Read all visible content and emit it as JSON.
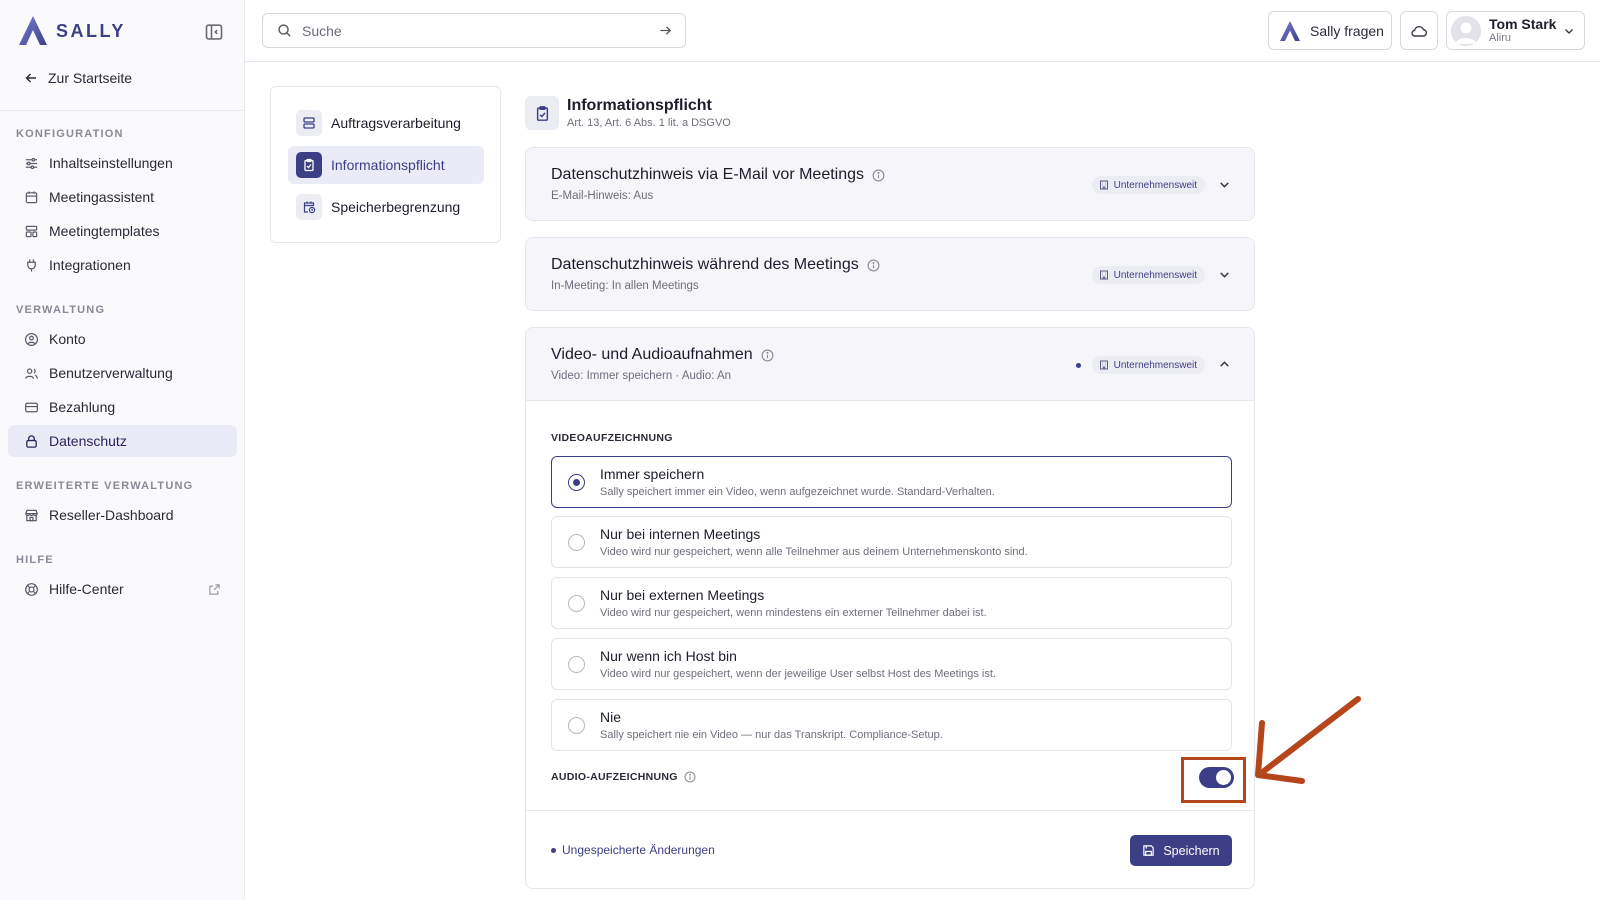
{
  "brand": {
    "name": "SALLY"
  },
  "sidebar": {
    "back_label": "Zur Startseite",
    "sections": [
      {
        "title": "KONFIGURATION",
        "items": [
          {
            "label": "Inhaltseinstellungen",
            "icon": "sliders-icon"
          },
          {
            "label": "Meetingassistent",
            "icon": "calendar-icon"
          },
          {
            "label": "Meetingtemplates",
            "icon": "template-icon"
          },
          {
            "label": "Integrationen",
            "icon": "plug-icon"
          }
        ]
      },
      {
        "title": "VERWALTUNG",
        "items": [
          {
            "label": "Konto",
            "icon": "user-circle-icon"
          },
          {
            "label": "Benutzerverwaltung",
            "icon": "users-icon"
          },
          {
            "label": "Bezahlung",
            "icon": "credit-card-icon"
          },
          {
            "label": "Datenschutz",
            "icon": "lock-icon",
            "active": true
          }
        ]
      },
      {
        "title": "ERWEITERTE VERWALTUNG",
        "items": [
          {
            "label": "Reseller-Dashboard",
            "icon": "store-icon"
          }
        ]
      },
      {
        "title": "HILFE",
        "items": [
          {
            "label": "Hilfe-Center",
            "icon": "lifebuoy-icon",
            "external": true
          }
        ]
      }
    ]
  },
  "topbar": {
    "search_placeholder": "Suche",
    "ask_label": "Sally fragen",
    "user": {
      "name": "Tom Stark",
      "org": "Aliru"
    }
  },
  "subnav": {
    "items": [
      {
        "label": "Auftragsverarbeitung",
        "icon": "server-icon"
      },
      {
        "label": "Informationspflicht",
        "icon": "clipboard-check-icon",
        "active": true
      },
      {
        "label": "Speicherbegrenzung",
        "icon": "calendar-clock-icon"
      }
    ]
  },
  "page": {
    "title": "Informationspflicht",
    "subtitle": "Art. 13, Art. 6 Abs. 1 lit. a DSGVO"
  },
  "accordions": [
    {
      "title": "Datenschutzhinweis via E-Mail vor Meetings",
      "summary": "E-Mail-Hinweis: Aus",
      "badge": "Unternehmensweit",
      "expanded": false
    },
    {
      "title": "Datenschutzhinweis während des Meetings",
      "summary": "In-Meeting: In allen Meetings",
      "badge": "Unternehmensweit",
      "expanded": false
    },
    {
      "title": "Video- und Audioaufnahmen",
      "summary": "Video: Immer speichern · Audio: An",
      "badge": "Unternehmensweit",
      "expanded": true,
      "modified": true
    }
  ],
  "video_section": {
    "label": "VIDEOAUFZEICHNUNG",
    "options": [
      {
        "title": "Immer speichern",
        "desc": "Sally speichert immer ein Video, wenn aufgezeichnet wurde. Standard-Verhalten.",
        "selected": true
      },
      {
        "title": "Nur bei internen Meetings",
        "desc": "Video wird nur gespeichert, wenn alle Teilnehmer aus deinem Unternehmenskonto sind.",
        "selected": false
      },
      {
        "title": "Nur bei externen Meetings",
        "desc": "Video wird nur gespeichert, wenn mindestens ein externer Teilnehmer dabei ist.",
        "selected": false
      },
      {
        "title": "Nur wenn ich Host bin",
        "desc": "Video wird nur gespeichert, wenn der jeweilige User selbst Host des Meetings ist.",
        "selected": false
      },
      {
        "title": "Nie",
        "desc": "Sally speichert nie ein Video — nur das Transkript. Compliance-Setup.",
        "selected": false
      }
    ]
  },
  "audio_section": {
    "label": "AUDIO-AUFZEICHNUNG",
    "enabled": true
  },
  "footer": {
    "unsaved_label": "Ungespeicherte Änderungen",
    "save_label": "Speichern"
  },
  "colors": {
    "accent": "#3d3f86",
    "annotation": "#b5461c"
  }
}
